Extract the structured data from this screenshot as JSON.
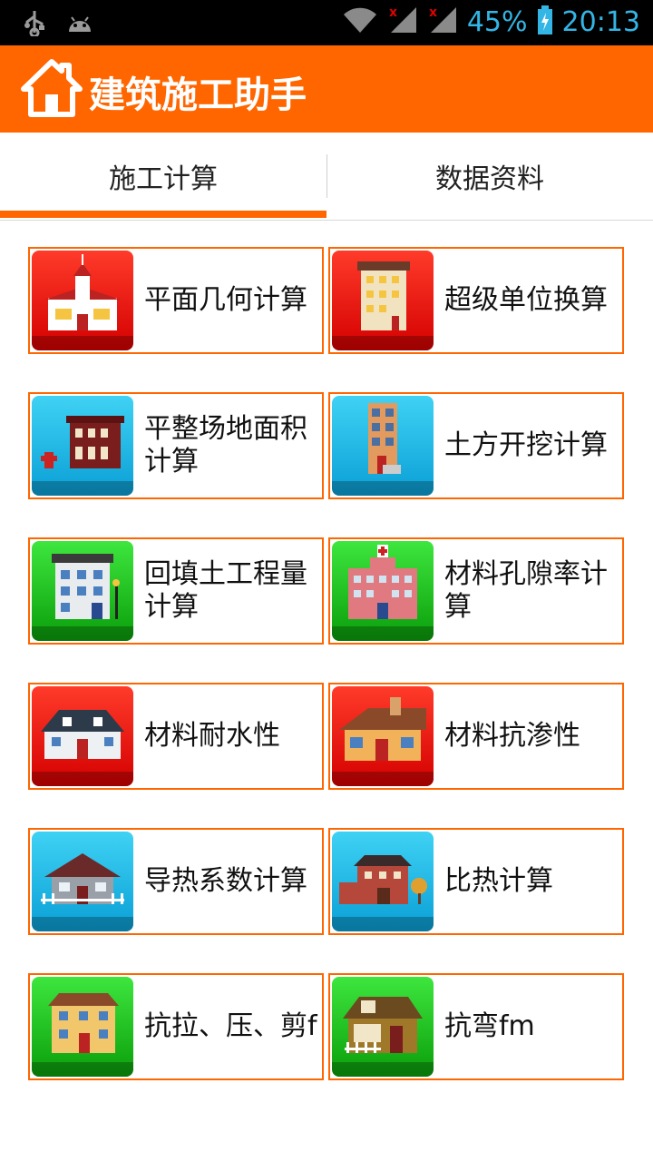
{
  "status_bar": {
    "battery_percent": "45%",
    "time": "20:13",
    "icons": [
      "usb-icon",
      "android-icon",
      "wifi-icon",
      "signal-x-icon",
      "signal-x-icon",
      "battery-charging-icon"
    ]
  },
  "header": {
    "title": "建筑施工助手",
    "icon": "home-icon",
    "color": "#ff6600"
  },
  "tabs": [
    {
      "label": "施工计算",
      "active": true
    },
    {
      "label": "数据资料",
      "active": false
    }
  ],
  "grid": [
    {
      "label": "平面几何计算",
      "icon": "church-icon",
      "tile_color": "red"
    },
    {
      "label": "超级单位换算",
      "icon": "apartment-building-icon",
      "tile_color": "red"
    },
    {
      "label": "平整场地面积计算",
      "icon": "hydrant-building-icon",
      "tile_color": "blue"
    },
    {
      "label": "土方开挖计算",
      "icon": "tower-building-icon",
      "tile_color": "blue"
    },
    {
      "label": "回填土工程量计算",
      "icon": "office-building-icon",
      "tile_color": "green"
    },
    {
      "label": "材料孔隙率计算",
      "icon": "hospital-icon",
      "tile_color": "green"
    },
    {
      "label": "材料耐水性",
      "icon": "mansion-icon",
      "tile_color": "red"
    },
    {
      "label": "材料抗渗性",
      "icon": "cottage-icon",
      "tile_color": "red"
    },
    {
      "label": "导热系数计算",
      "icon": "house-fence-icon",
      "tile_color": "blue"
    },
    {
      "label": "比热计算",
      "icon": "townhouse-tree-icon",
      "tile_color": "blue"
    },
    {
      "label": "抗拉、压、剪f",
      "icon": "yellow-house-icon",
      "tile_color": "green"
    },
    {
      "label": "抗弯fm",
      "icon": "cabin-icon",
      "tile_color": "green"
    }
  ]
}
